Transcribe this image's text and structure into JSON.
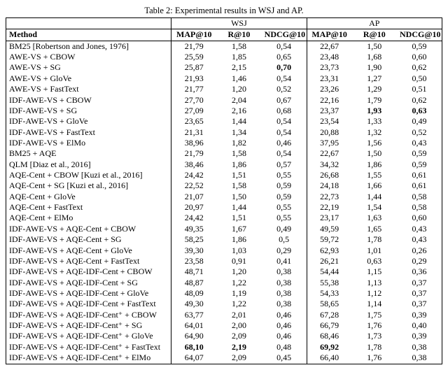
{
  "caption": "Table 2: Experimental results in WSJ and AP.",
  "groups": {
    "method": "Method",
    "wsj": "WSJ",
    "ap": "AP"
  },
  "cols": {
    "map10": "MAP@10",
    "r10": "R@10",
    "ndcg10": "NDCG@10"
  },
  "chart_data": {
    "type": "table",
    "columns": [
      "Method",
      "WSJ_MAP@10",
      "WSJ_R@10",
      "WSJ_NDCG@10",
      "AP_MAP@10",
      "AP_R@10",
      "AP_NDCG@10"
    ],
    "rows": [
      {
        "method": "BM25 [Robertson and Jones, 1976]",
        "wsj": [
          "21,79",
          "1,58",
          "0,54"
        ],
        "ap": [
          "22,67",
          "1,50",
          "0,59"
        ],
        "bold": []
      },
      {
        "method": "AWE-VS + CBOW",
        "wsj": [
          "25,59",
          "1,85",
          "0,65"
        ],
        "ap": [
          "23,48",
          "1,68",
          "0,60"
        ],
        "bold": []
      },
      {
        "method": "AWE-VS + SG",
        "wsj": [
          "25,87",
          "2,15",
          "0,70"
        ],
        "ap": [
          "23,73",
          "1,90",
          "0,62"
        ],
        "bold": [
          "wsj2"
        ]
      },
      {
        "method": "AWE-VS + GloVe",
        "wsj": [
          "21,93",
          "1,46",
          "0,54"
        ],
        "ap": [
          "23,31",
          "1,27",
          "0,50"
        ],
        "bold": []
      },
      {
        "method": "AWE-VS + FastText",
        "wsj": [
          "21,77",
          "1,20",
          "0,52"
        ],
        "ap": [
          "23,26",
          "1,29",
          "0,51"
        ],
        "bold": []
      },
      {
        "method": "IDF-AWE-VS + CBOW",
        "wsj": [
          "27,70",
          "2,04",
          "0,67"
        ],
        "ap": [
          "22,16",
          "1,79",
          "0,62"
        ],
        "bold": []
      },
      {
        "method": "IDF-AWE-VS + SG",
        "wsj": [
          "27,09",
          "2,16",
          "0,68"
        ],
        "ap": [
          "23,37",
          "1,93",
          "0,63"
        ],
        "bold": [
          "ap1",
          "ap2"
        ]
      },
      {
        "method": "IDF-AWE-VS + GloVe",
        "wsj": [
          "23,65",
          "1,44",
          "0,54"
        ],
        "ap": [
          "23,54",
          "1,33",
          "0,49"
        ],
        "bold": []
      },
      {
        "method": "IDF-AWE-VS + FastText",
        "wsj": [
          "21,31",
          "1,34",
          "0,54"
        ],
        "ap": [
          "20,88",
          "1,32",
          "0,52"
        ],
        "bold": []
      },
      {
        "method": "IDF-AWE-VS + ElMo",
        "wsj": [
          "38,96",
          "1,82",
          "0,46"
        ],
        "ap": [
          "37,95",
          "1,56",
          "0,43"
        ],
        "bold": []
      },
      {
        "method": "BM25 + AQE",
        "wsj": [
          "21,79",
          "1,58",
          "0,54"
        ],
        "ap": [
          "22,67",
          "1,50",
          "0,59"
        ],
        "bold": []
      },
      {
        "method": "QLM [Diaz et al., 2016]",
        "wsj": [
          "38,46",
          "1,86",
          "0,57"
        ],
        "ap": [
          "34,32",
          "1,86",
          "0,59"
        ],
        "bold": []
      },
      {
        "method": "AQE-Cent + CBOW [Kuzi et al., 2016]",
        "wsj": [
          "24,42",
          "1,51",
          "0,55"
        ],
        "ap": [
          "26,68",
          "1,55",
          "0,61"
        ],
        "bold": []
      },
      {
        "method": "AQE-Cent + SG [Kuzi et al., 2016]",
        "wsj": [
          "22,52",
          "1,58",
          "0,59"
        ],
        "ap": [
          "24,18",
          "1,66",
          "0,61"
        ],
        "bold": []
      },
      {
        "method": "AQE-Cent + GloVe",
        "wsj": [
          "21,07",
          "1,50",
          "0,59"
        ],
        "ap": [
          "22,73",
          "1,44",
          "0,58"
        ],
        "bold": []
      },
      {
        "method": "AQE-Cent + FastText",
        "wsj": [
          "20,97",
          "1,44",
          "0,55"
        ],
        "ap": [
          "22,19",
          "1,54",
          "0,58"
        ],
        "bold": []
      },
      {
        "method": "AQE-Cent + ElMo",
        "wsj": [
          "24,42",
          "1,51",
          "0,55"
        ],
        "ap": [
          "23,17",
          "1,63",
          "0,60"
        ],
        "bold": []
      },
      {
        "method": "IDF-AWE-VS + AQE-Cent + CBOW",
        "wsj": [
          "49,35",
          "1,67",
          "0,49"
        ],
        "ap": [
          "49,59",
          "1,65",
          "0,43"
        ],
        "bold": []
      },
      {
        "method": "IDF-AWE-VS + AQE-Cent + SG",
        "wsj": [
          "58,25",
          "1,86",
          "0,5"
        ],
        "ap": [
          "59,72",
          "1,78",
          "0,43"
        ],
        "bold": []
      },
      {
        "method": "IDF-AWE-VS + AQE-Cent + GloVe",
        "wsj": [
          "39,30",
          "1,03",
          "0,29"
        ],
        "ap": [
          "62,93",
          "1,01",
          "0,26"
        ],
        "bold": []
      },
      {
        "method": "IDF-AWE-VS + AQE-Cent + FastText",
        "wsj": [
          "23,58",
          "0,91",
          "0,41"
        ],
        "ap": [
          "26,21",
          "0,63",
          "0,29"
        ],
        "bold": []
      },
      {
        "method": "IDF-AWE-VS + AQE-IDF-Cent + CBOW",
        "wsj": [
          "48,71",
          "1,20",
          "0,38"
        ],
        "ap": [
          "54,44",
          "1,15",
          "0,36"
        ],
        "bold": []
      },
      {
        "method": "IDF-AWE-VS + AQE-IDF-Cent + SG",
        "wsj": [
          "48,87",
          "1,22",
          "0,38"
        ],
        "ap": [
          "55,38",
          "1,13",
          "0,37"
        ],
        "bold": []
      },
      {
        "method": "IDF-AWE-VS + AQE-IDF-Cent + GloVe",
        "wsj": [
          "48,09",
          "1,19",
          "0,38"
        ],
        "ap": [
          "54,33",
          "1,12",
          "0,37"
        ],
        "bold": []
      },
      {
        "method": "IDF-AWE-VS + AQE-IDF-Cent + FastText",
        "wsj": [
          "49,30",
          "1,22",
          "0,38"
        ],
        "ap": [
          "58,65",
          "1,14",
          "0,37"
        ],
        "bold": []
      },
      {
        "method": "IDF-AWE-VS + AQE-IDF-Cent⁺ + CBOW",
        "wsj": [
          "63,77",
          "2,01",
          "0,46"
        ],
        "ap": [
          "67,28",
          "1,75",
          "0,39"
        ],
        "bold": []
      },
      {
        "method": "IDF-AWE-VS + AQE-IDF-Cent⁺ + SG",
        "wsj": [
          "64,01",
          "2,00",
          "0,46"
        ],
        "ap": [
          "66,79",
          "1,76",
          "0,40"
        ],
        "bold": []
      },
      {
        "method": "IDF-AWE-VS + AQE-IDF-Cent⁺ + GloVe",
        "wsj": [
          "64,90",
          "2,09",
          "0,46"
        ],
        "ap": [
          "68,46",
          "1,73",
          "0,39"
        ],
        "bold": []
      },
      {
        "method": "IDF-AWE-VS + AQE-IDF-Cent⁺ + FastText",
        "wsj": [
          "68,10",
          "2,19",
          "0,48"
        ],
        "ap": [
          "69,92",
          "1,78",
          "0,38"
        ],
        "bold": [
          "wsj0",
          "wsj1",
          "ap0"
        ]
      },
      {
        "method": "IDF-AWE-VS + AQE-IDF-Cent⁺ + ElMo",
        "wsj": [
          "64,07",
          "2,09",
          "0,45"
        ],
        "ap": [
          "66,40",
          "1,76",
          "0,38"
        ],
        "bold": []
      }
    ]
  }
}
